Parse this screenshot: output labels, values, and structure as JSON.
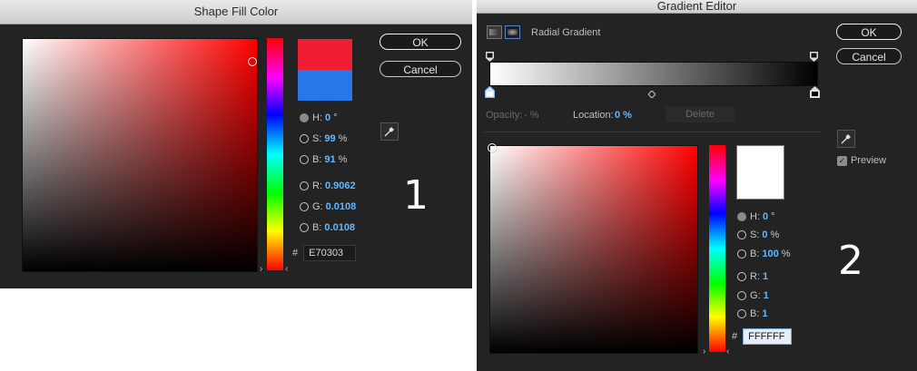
{
  "panel1": {
    "title": "Shape Fill Color",
    "ok_label": "OK",
    "cancel_label": "Cancel",
    "new_color": "#ef1e33",
    "old_color": "#2777e8",
    "fields": {
      "h": {
        "label": "H:",
        "value": "0",
        "unit": "°"
      },
      "s": {
        "label": "S:",
        "value": "99",
        "unit": "%"
      },
      "b": {
        "label": "B:",
        "value": "91",
        "unit": "%"
      },
      "r": {
        "label": "R:",
        "value": "0.9062"
      },
      "g": {
        "label": "G:",
        "value": "0.0108"
      },
      "b2": {
        "label": "B:",
        "value": "0.0108"
      }
    },
    "hex_prefix": "#",
    "hex_value": "E70303",
    "annotation": "1"
  },
  "panel2": {
    "title": "Gradient Editor",
    "gradient_type_label": "Radial Gradient",
    "ok_label": "OK",
    "cancel_label": "Cancel",
    "opacity_label": "Opacity:",
    "opacity_value": "- %",
    "location_label": "Location:",
    "location_value": "0 %",
    "delete_label": "Delete",
    "preview_label": "Preview",
    "preview_checked": true,
    "new_color": "#ffffff",
    "fields": {
      "h": {
        "label": "H:",
        "value": "0",
        "unit": "°"
      },
      "s": {
        "label": "S:",
        "value": "0",
        "unit": "%"
      },
      "b": {
        "label": "B:",
        "value": "100",
        "unit": "%"
      },
      "r": {
        "label": "R:",
        "value": "1"
      },
      "g": {
        "label": "G:",
        "value": "1"
      },
      "b2": {
        "label": "B:",
        "value": "1"
      }
    },
    "hex_prefix": "#",
    "hex_value": "FFFFFF",
    "annotation": "2"
  }
}
